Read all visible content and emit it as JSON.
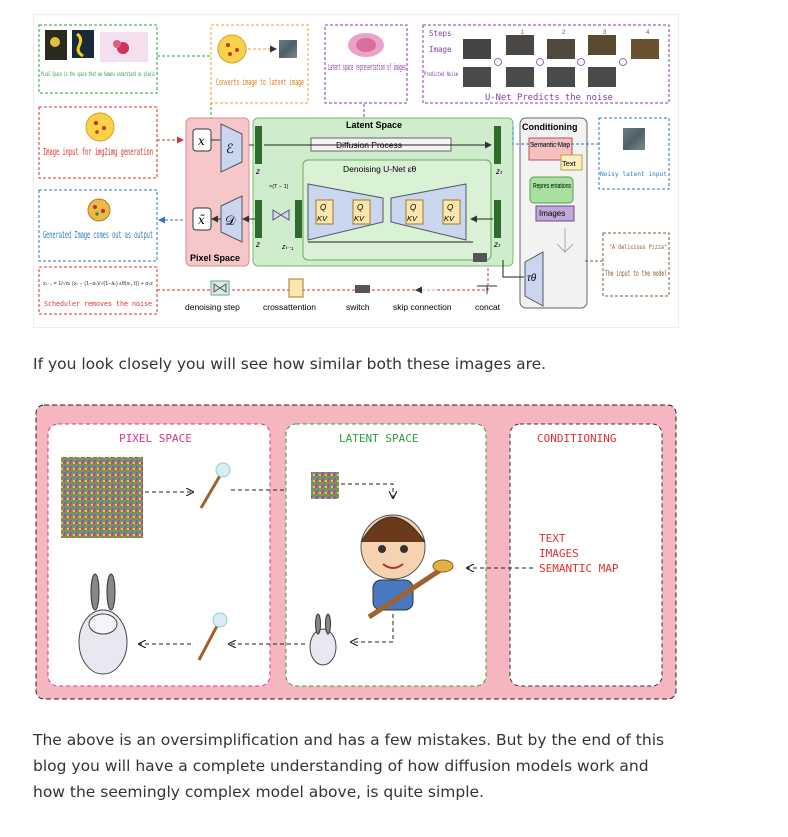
{
  "figure1": {
    "pixel_space_caption": "Pixel Space is the space that we humans understand as pixels",
    "converts_caption": "Converts image to latent image",
    "latent_caption": "Latent space representation of images",
    "steps_label": "Steps",
    "image_label": "Image",
    "predicted_noise_label": "Predicted Noise",
    "step_numbers": [
      "1",
      "2",
      "3",
      "4"
    ],
    "unet_predicts": "U-Net Predicts the noise",
    "img2img_caption": "Image input for img2img generation",
    "generated_caption": "Generated Image comes out as output",
    "scheduler_caption": "Scheduler removes the noise",
    "scheduler_formula": "xₜ₋₁ = 1/√αₜ (xₜ − (1−αₜ)/√(1−āₜ) εθ(xₜ, t)) + σₜz",
    "latent_space_title": "Latent Space",
    "diffusion_process": "Diffusion Process",
    "denoising_unet": "Denoising U-Net εθ",
    "pixel_space_title": "Pixel Space",
    "conditioning_title": "Conditioning",
    "semantic_map": "Semantic Map",
    "text_label": "Text",
    "representations": "Repres entations",
    "images_label": "Images",
    "noisy_latent": "Noisy latent input",
    "prompt": "\"A delicious Pizza\"",
    "input_caption": "The input to the model",
    "legend": [
      "denoising step",
      "crossattention",
      "switch",
      "skip connection",
      "concat"
    ],
    "symbols": {
      "x": "x",
      "E": "ℰ",
      "xt": "x̃",
      "D": "𝒟",
      "z": "z",
      "zT": "zₜ",
      "zT1": "zₜ₋₁",
      "tau": "τθ",
      "times": "×(T − 1)",
      "Q": "Q",
      "KV": "KV"
    }
  },
  "paragraph1": "If you look closely you will see how similar both these images are.",
  "figure2": {
    "pixel_space": "PIXEL SPACE",
    "latent_space": "LATENT SPACE",
    "conditioning": "CONDITIONING",
    "cond_items": [
      "TEXT",
      "IMAGES",
      "SEMANTIC MAP"
    ]
  },
  "paragraph2": "The above is an oversimplification and has a few mistakes. But by the end of this blog you will have a complete understanding of how diffusion models work and how the seemingly complex model above, is quite simple."
}
